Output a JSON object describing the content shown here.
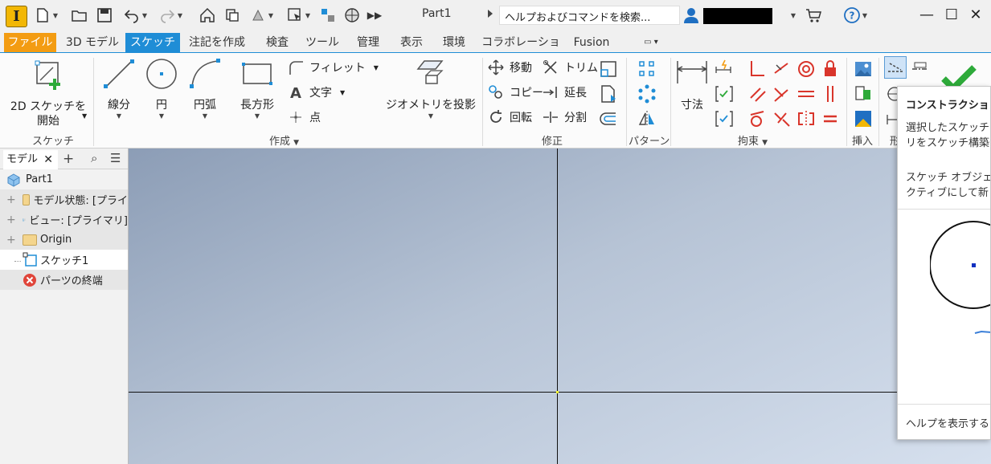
{
  "titlebar": {
    "app_letter": "I",
    "doc_title": "Part1",
    "search_placeholder": "ヘルプおよびコマンドを検索..."
  },
  "menu": {
    "tabs": [
      "ファイル",
      "3D モデル",
      "スケッチ",
      "注記を作成",
      "検査",
      "ツール",
      "管理",
      "表示",
      "環境",
      "コラボレーション",
      "Fusion"
    ],
    "active": "スケッチ"
  },
  "ribbon": {
    "sketch_panel": {
      "start_label_1": "2D スケッチを",
      "start_label_2": "開始",
      "panel_label": "スケッチ"
    },
    "create_panel": {
      "line": "線分",
      "circle": "円",
      "arc": "円弧",
      "rectangle": "長方形",
      "fillet": "フィレット",
      "text": "文字",
      "point": "点",
      "project": "ジオメトリを投影",
      "panel_label": "作成"
    },
    "modify_panel": {
      "move": "移動",
      "copy": "コピー",
      "rotate": "回転",
      "trim": "トリム",
      "extend": "延長",
      "split": "分割",
      "panel_label": "修正"
    },
    "pattern_panel": {
      "panel_label": "パターン"
    },
    "constrain_panel": {
      "dimension": "寸法",
      "panel_label": "拘束"
    },
    "insert_panel": {
      "panel_label": "挿入"
    },
    "format_panel": {
      "panel_label": "形"
    }
  },
  "browser": {
    "tab_label": "モデル",
    "items": [
      {
        "label": "Part1"
      },
      {
        "label": "モデル状態: [プライ"
      },
      {
        "label": "ビュー: [プライマリ]"
      },
      {
        "label": "Origin"
      },
      {
        "label": "スケッチ1"
      },
      {
        "label": "パーツの終端"
      }
    ]
  },
  "tooltip": {
    "title": "コンストラクション",
    "line1": "選択したスケッチ ジ",
    "line2": "リをスケッチ構築ジ",
    "line3": "スケッチ オブジェクト",
    "line4": "クティブにして新しし",
    "help": "ヘルプを表示するに"
  },
  "colors": {
    "accent": "#1f8dd6",
    "file_tab": "#f39c12",
    "finish_check": "#2eaa3a",
    "origin": "#ffff33"
  }
}
